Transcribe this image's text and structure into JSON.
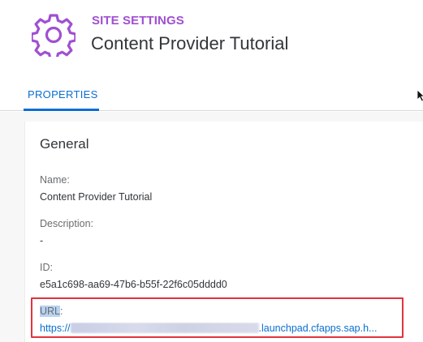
{
  "header": {
    "site_label": "SITE SETTINGS",
    "title": "Content Provider Tutorial",
    "icon": "gear-icon"
  },
  "tabs": [
    {
      "label": "PROPERTIES",
      "active": true
    }
  ],
  "section": {
    "title": "General",
    "fields": {
      "name": {
        "label": "Name:",
        "value": "Content Provider Tutorial"
      },
      "description": {
        "label": "Description:",
        "value": "-"
      },
      "id": {
        "label": "ID:",
        "value": "e5a1c698-aa69-47b6-b55f-22f6c05dddd0"
      },
      "url": {
        "label": "URL",
        "label_suffix": ":",
        "value_prefix": "https://",
        "value_suffix": ".launchpad.cfapps.sap.h..."
      }
    }
  },
  "colors": {
    "accent": "#a04fd2",
    "link": "#0a6ed1",
    "highlight_border": "#e0343e"
  }
}
